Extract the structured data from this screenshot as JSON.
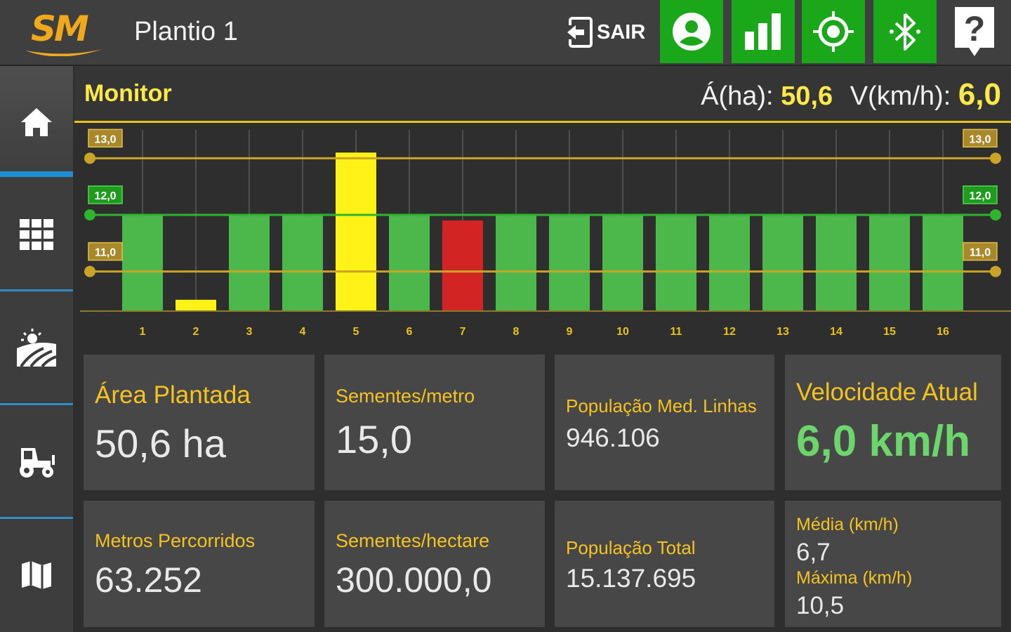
{
  "header": {
    "logo_text": "SM",
    "title": "Plantio 1",
    "exit_label": "SAIR",
    "help_label": "?"
  },
  "monitor": {
    "title": "Monitor",
    "area_label": "Á(ha):",
    "area_value": "50,6",
    "speed_label": "V(km/h):",
    "speed_value": "6,0"
  },
  "chart_data": {
    "type": "bar",
    "categories": [
      "1",
      "2",
      "3",
      "4",
      "5",
      "6",
      "7",
      "8",
      "9",
      "10",
      "11",
      "12",
      "13",
      "14",
      "15",
      "16"
    ],
    "values": [
      12.0,
      10.5,
      12.0,
      12.0,
      13.1,
      12.0,
      11.9,
      12.0,
      12.0,
      12.0,
      12.0,
      12.0,
      12.0,
      12.0,
      12.0,
      12.0
    ],
    "statuses": [
      "ok",
      "low",
      "ok",
      "ok",
      "high",
      "ok",
      "alarm",
      "ok",
      "ok",
      "ok",
      "ok",
      "ok",
      "ok",
      "ok",
      "ok",
      "ok"
    ],
    "ylim": [
      10.3,
      13.5
    ],
    "reference_lines": [
      {
        "value": 13.0,
        "label": "13,0",
        "color": "#c9a427"
      },
      {
        "value": 12.0,
        "label": "12,0",
        "color": "#2db52d"
      },
      {
        "value": 11.0,
        "label": "11,0",
        "color": "#c9a427"
      }
    ],
    "colors": {
      "ok": "#4cb84c",
      "low": "#fff216",
      "high": "#fff216",
      "alarm": "#d32424"
    },
    "grid": true
  },
  "cards": {
    "area_plantada": {
      "label": "Área Plantada",
      "value": "50,6 ha"
    },
    "sementes_metro": {
      "label": "Sementes/metro",
      "value": "15,0"
    },
    "populacao_med": {
      "label": "População Med. Linhas",
      "value": "946.106"
    },
    "velocidade_atual": {
      "label": "Velocidade Atual",
      "value": "6,0 km/h"
    },
    "metros_percorridos": {
      "label": "Metros Percorridos",
      "value": "63.252"
    },
    "sementes_hectare": {
      "label": "Sementes/hectare",
      "value": "300.000,0"
    },
    "populacao_total": {
      "label": "População Total",
      "value": "15.137.695"
    },
    "media_label": "Média (km/h)",
    "media_value": "6,7",
    "maxima_label": "Máxima (km/h)",
    "maxima_value": "10,5"
  },
  "colors": {
    "accent_yellow": "#f5c320",
    "accent_green": "#1aa81a",
    "speed_green": "#6cd56c",
    "sidebar_blue": "#2f8ec9"
  }
}
